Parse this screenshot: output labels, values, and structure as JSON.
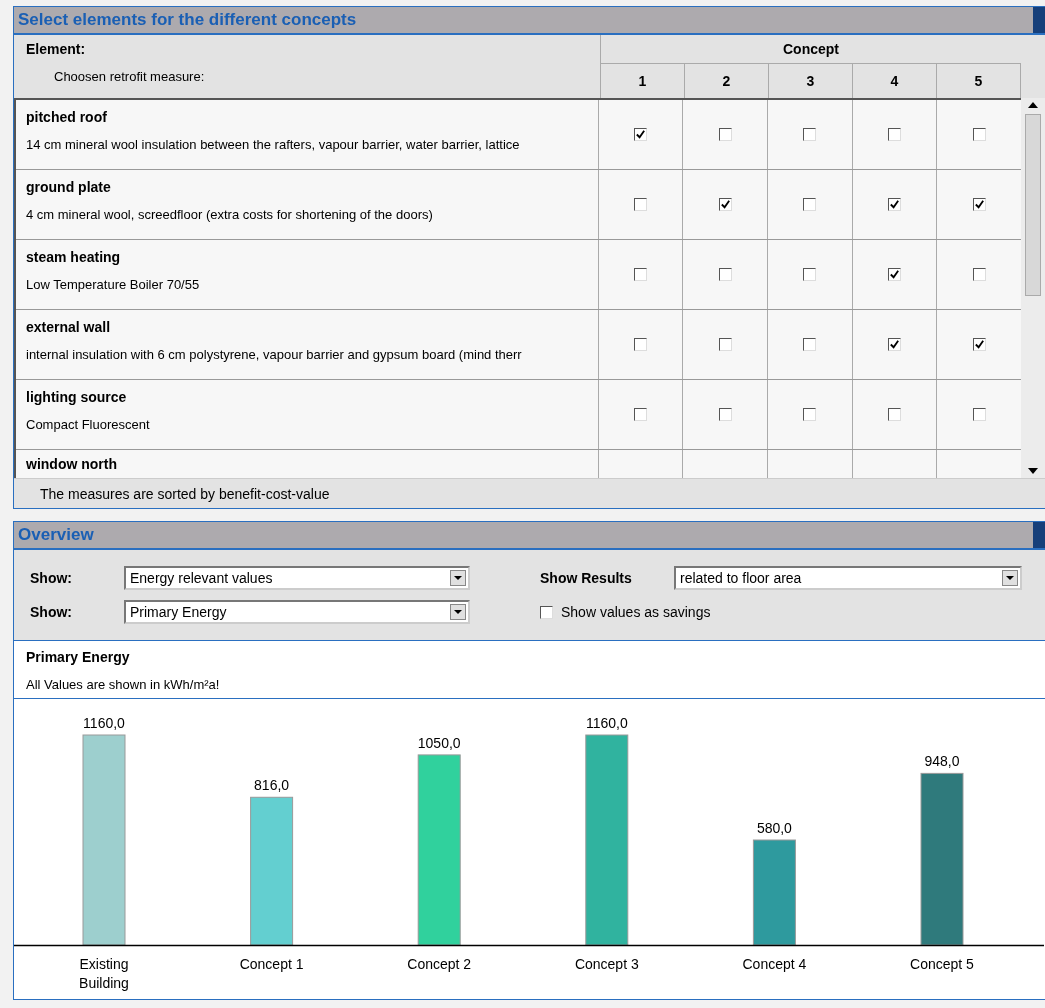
{
  "selection_panel": {
    "title": "Select elements for the different concepts",
    "table": {
      "element_header": "Element:",
      "measure_header": "Choosen retrofit measure:",
      "concept_header": "Concept",
      "concept_columns": [
        "1",
        "2",
        "3",
        "4",
        "5"
      ],
      "rows": [
        {
          "name": "pitched roof",
          "measure": "14 cm mineral wool insulation between the rafters, vapour barrier, water barrier, lattice",
          "concepts": [
            {
              "checked": true
            },
            {
              "checked": false
            },
            {
              "checked": false
            },
            {
              "checked": false
            },
            {
              "checked": false
            }
          ]
        },
        {
          "name": "ground plate",
          "measure": "4 cm mineral wool, screedfloor (extra costs for shortening of the doors)",
          "concepts": [
            {
              "checked": false
            },
            {
              "checked": true
            },
            {
              "checked": false
            },
            {
              "checked": true
            },
            {
              "checked": true
            }
          ]
        },
        {
          "name": "steam heating",
          "measure": "Low Temperature Boiler 70/55",
          "concepts": [
            {
              "checked": false
            },
            {
              "checked": false
            },
            {
              "checked": false
            },
            {
              "checked": true
            },
            {
              "checked": false
            }
          ]
        },
        {
          "name": "external wall",
          "measure": "internal insulation with 6 cm polystyrene, vapour barrier and gypsum board (mind therr",
          "concepts": [
            {
              "checked": false
            },
            {
              "checked": false
            },
            {
              "checked": false
            },
            {
              "checked": true
            },
            {
              "checked": true
            }
          ]
        },
        {
          "name": "lighting source",
          "measure": "Compact Fluorescent",
          "concepts": [
            {
              "checked": false
            },
            {
              "checked": false
            },
            {
              "checked": false
            },
            {
              "checked": false
            },
            {
              "checked": false
            }
          ]
        },
        {
          "name": "window north"
        }
      ],
      "footer": "The measures are sorted by benefit-cost-value"
    }
  },
  "overview_panel": {
    "title": "Overview",
    "controls": {
      "show_1": {
        "label": "Show:",
        "value": "Energy relevant values"
      },
      "show_2": {
        "label": "Show:",
        "value": "Primary Energy"
      },
      "show_results": {
        "label": "Show Results",
        "value": "related to floor area"
      },
      "savings": {
        "label": "Show values as savings",
        "checked": false
      }
    },
    "heading": "Primary Energy",
    "unit_note": "All Values are shown in kWh/m²a!",
    "chart_data": {
      "type": "bar",
      "categories": [
        "Existing Building",
        "Concept 1",
        "Concept 2",
        "Concept 3",
        "Concept 4",
        "Concept 5"
      ],
      "values": [
        1160,
        816,
        1050,
        1160,
        580,
        948
      ],
      "colors": [
        "#9dcfce",
        "#63cfd0",
        "#30d19d",
        "#30b39f",
        "#2e9a9e",
        "#2f7a7c"
      ],
      "ylim": [
        0,
        1160
      ],
      "value_labels": [
        "1160,0",
        "816,0",
        "1050,0",
        "1160,0",
        "580,0",
        "948,0"
      ]
    }
  }
}
